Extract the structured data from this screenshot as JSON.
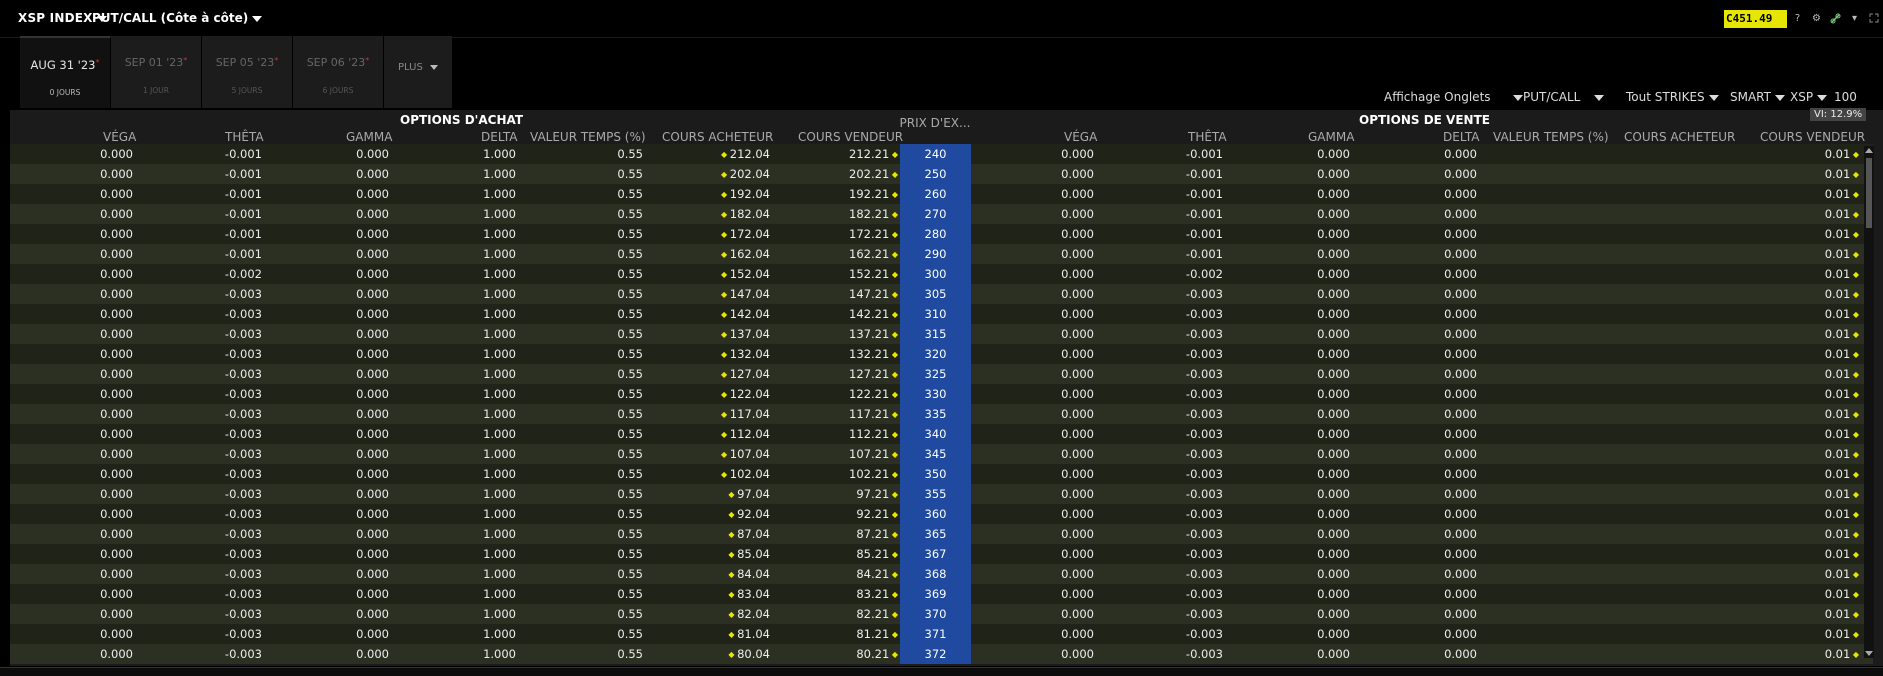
{
  "toolbar": {
    "symbol": "XSP INDEX",
    "view": "PUT/CALL (Côte à côte)",
    "price": "C451.49",
    "help": "?"
  },
  "tabs": [
    {
      "date": "AUG 31 '23",
      "days": "0 JOURS",
      "active": true
    },
    {
      "date": "SEP 01 '23",
      "days": "1 JOUR",
      "active": false
    },
    {
      "date": "SEP 05 '23",
      "days": "5 JOURS",
      "active": false
    },
    {
      "date": "SEP 06 '23",
      "days": "6 JOURS",
      "active": false
    }
  ],
  "more_tab": "PLUS",
  "controls": {
    "display": "Affichage Onglets",
    "putcall": "PUT/CALL",
    "strikes": "Tout STRIKES",
    "exchange": "SMART",
    "underlying": "XSP",
    "multiplier": "100"
  },
  "calls": {
    "title": "OPTIONS D'ACHAT",
    "columns": [
      "VÉGA",
      "THÊTA",
      "GAMMA",
      "DELTA",
      "VALEUR TEMPS (%)",
      "COURS ACHETEUR",
      "COURS VENDEUR"
    ]
  },
  "strike_header": "PRIX D'EX...",
  "puts": {
    "title": "OPTIONS DE VENTE",
    "columns": [
      "VÉGA",
      "THÊTA",
      "GAMMA",
      "DELTA",
      "VALEUR TEMPS (%)",
      "COURS ACHETEUR",
      "COURS VENDEUR"
    ]
  },
  "vi": "VI: 12.9%",
  "rows": [
    {
      "cv": "0.000",
      "ct": "-0.001",
      "cg": "0.000",
      "cd": "1.000",
      "ctv": "0.55",
      "cb": "212.04",
      "ca": "212.21",
      "strike": "240",
      "pv": "0.000",
      "pt": "-0.001",
      "pg": "0.000",
      "pd": "0.000",
      "pa": "0.01"
    },
    {
      "cv": "0.000",
      "ct": "-0.001",
      "cg": "0.000",
      "cd": "1.000",
      "ctv": "0.55",
      "cb": "202.04",
      "ca": "202.21",
      "strike": "250",
      "pv": "0.000",
      "pt": "-0.001",
      "pg": "0.000",
      "pd": "0.000",
      "pa": "0.01"
    },
    {
      "cv": "0.000",
      "ct": "-0.001",
      "cg": "0.000",
      "cd": "1.000",
      "ctv": "0.55",
      "cb": "192.04",
      "ca": "192.21",
      "strike": "260",
      "pv": "0.000",
      "pt": "-0.001",
      "pg": "0.000",
      "pd": "0.000",
      "pa": "0.01"
    },
    {
      "cv": "0.000",
      "ct": "-0.001",
      "cg": "0.000",
      "cd": "1.000",
      "ctv": "0.55",
      "cb": "182.04",
      "ca": "182.21",
      "strike": "270",
      "pv": "0.000",
      "pt": "-0.001",
      "pg": "0.000",
      "pd": "0.000",
      "pa": "0.01"
    },
    {
      "cv": "0.000",
      "ct": "-0.001",
      "cg": "0.000",
      "cd": "1.000",
      "ctv": "0.55",
      "cb": "172.04",
      "ca": "172.21",
      "strike": "280",
      "pv": "0.000",
      "pt": "-0.001",
      "pg": "0.000",
      "pd": "0.000",
      "pa": "0.01"
    },
    {
      "cv": "0.000",
      "ct": "-0.001",
      "cg": "0.000",
      "cd": "1.000",
      "ctv": "0.55",
      "cb": "162.04",
      "ca": "162.21",
      "strike": "290",
      "pv": "0.000",
      "pt": "-0.001",
      "pg": "0.000",
      "pd": "0.000",
      "pa": "0.01"
    },
    {
      "cv": "0.000",
      "ct": "-0.002",
      "cg": "0.000",
      "cd": "1.000",
      "ctv": "0.55",
      "cb": "152.04",
      "ca": "152.21",
      "strike": "300",
      "pv": "0.000",
      "pt": "-0.002",
      "pg": "0.000",
      "pd": "0.000",
      "pa": "0.01"
    },
    {
      "cv": "0.000",
      "ct": "-0.003",
      "cg": "0.000",
      "cd": "1.000",
      "ctv": "0.55",
      "cb": "147.04",
      "ca": "147.21",
      "strike": "305",
      "pv": "0.000",
      "pt": "-0.003",
      "pg": "0.000",
      "pd": "0.000",
      "pa": "0.01"
    },
    {
      "cv": "0.000",
      "ct": "-0.003",
      "cg": "0.000",
      "cd": "1.000",
      "ctv": "0.55",
      "cb": "142.04",
      "ca": "142.21",
      "strike": "310",
      "pv": "0.000",
      "pt": "-0.003",
      "pg": "0.000",
      "pd": "0.000",
      "pa": "0.01"
    },
    {
      "cv": "0.000",
      "ct": "-0.003",
      "cg": "0.000",
      "cd": "1.000",
      "ctv": "0.55",
      "cb": "137.04",
      "ca": "137.21",
      "strike": "315",
      "pv": "0.000",
      "pt": "-0.003",
      "pg": "0.000",
      "pd": "0.000",
      "pa": "0.01"
    },
    {
      "cv": "0.000",
      "ct": "-0.003",
      "cg": "0.000",
      "cd": "1.000",
      "ctv": "0.55",
      "cb": "132.04",
      "ca": "132.21",
      "strike": "320",
      "pv": "0.000",
      "pt": "-0.003",
      "pg": "0.000",
      "pd": "0.000",
      "pa": "0.01"
    },
    {
      "cv": "0.000",
      "ct": "-0.003",
      "cg": "0.000",
      "cd": "1.000",
      "ctv": "0.55",
      "cb": "127.04",
      "ca": "127.21",
      "strike": "325",
      "pv": "0.000",
      "pt": "-0.003",
      "pg": "0.000",
      "pd": "0.000",
      "pa": "0.01"
    },
    {
      "cv": "0.000",
      "ct": "-0.003",
      "cg": "0.000",
      "cd": "1.000",
      "ctv": "0.55",
      "cb": "122.04",
      "ca": "122.21",
      "strike": "330",
      "pv": "0.000",
      "pt": "-0.003",
      "pg": "0.000",
      "pd": "0.000",
      "pa": "0.01"
    },
    {
      "cv": "0.000",
      "ct": "-0.003",
      "cg": "0.000",
      "cd": "1.000",
      "ctv": "0.55",
      "cb": "117.04",
      "ca": "117.21",
      "strike": "335",
      "pv": "0.000",
      "pt": "-0.003",
      "pg": "0.000",
      "pd": "0.000",
      "pa": "0.01"
    },
    {
      "cv": "0.000",
      "ct": "-0.003",
      "cg": "0.000",
      "cd": "1.000",
      "ctv": "0.55",
      "cb": "112.04",
      "ca": "112.21",
      "strike": "340",
      "pv": "0.000",
      "pt": "-0.003",
      "pg": "0.000",
      "pd": "0.000",
      "pa": "0.01"
    },
    {
      "cv": "0.000",
      "ct": "-0.003",
      "cg": "0.000",
      "cd": "1.000",
      "ctv": "0.55",
      "cb": "107.04",
      "ca": "107.21",
      "strike": "345",
      "pv": "0.000",
      "pt": "-0.003",
      "pg": "0.000",
      "pd": "0.000",
      "pa": "0.01"
    },
    {
      "cv": "0.000",
      "ct": "-0.003",
      "cg": "0.000",
      "cd": "1.000",
      "ctv": "0.55",
      "cb": "102.04",
      "ca": "102.21",
      "strike": "350",
      "pv": "0.000",
      "pt": "-0.003",
      "pg": "0.000",
      "pd": "0.000",
      "pa": "0.01"
    },
    {
      "cv": "0.000",
      "ct": "-0.003",
      "cg": "0.000",
      "cd": "1.000",
      "ctv": "0.55",
      "cb": "97.04",
      "ca": "97.21",
      "strike": "355",
      "pv": "0.000",
      "pt": "-0.003",
      "pg": "0.000",
      "pd": "0.000",
      "pa": "0.01"
    },
    {
      "cv": "0.000",
      "ct": "-0.003",
      "cg": "0.000",
      "cd": "1.000",
      "ctv": "0.55",
      "cb": "92.04",
      "ca": "92.21",
      "strike": "360",
      "pv": "0.000",
      "pt": "-0.003",
      "pg": "0.000",
      "pd": "0.000",
      "pa": "0.01"
    },
    {
      "cv": "0.000",
      "ct": "-0.003",
      "cg": "0.000",
      "cd": "1.000",
      "ctv": "0.55",
      "cb": "87.04",
      "ca": "87.21",
      "strike": "365",
      "pv": "0.000",
      "pt": "-0.003",
      "pg": "0.000",
      "pd": "0.000",
      "pa": "0.01"
    },
    {
      "cv": "0.000",
      "ct": "-0.003",
      "cg": "0.000",
      "cd": "1.000",
      "ctv": "0.55",
      "cb": "85.04",
      "ca": "85.21",
      "strike": "367",
      "pv": "0.000",
      "pt": "-0.003",
      "pg": "0.000",
      "pd": "0.000",
      "pa": "0.01"
    },
    {
      "cv": "0.000",
      "ct": "-0.003",
      "cg": "0.000",
      "cd": "1.000",
      "ctv": "0.55",
      "cb": "84.04",
      "ca": "84.21",
      "strike": "368",
      "pv": "0.000",
      "pt": "-0.003",
      "pg": "0.000",
      "pd": "0.000",
      "pa": "0.01"
    },
    {
      "cv": "0.000",
      "ct": "-0.003",
      "cg": "0.000",
      "cd": "1.000",
      "ctv": "0.55",
      "cb": "83.04",
      "ca": "83.21",
      "strike": "369",
      "pv": "0.000",
      "pt": "-0.003",
      "pg": "0.000",
      "pd": "0.000",
      "pa": "0.01"
    },
    {
      "cv": "0.000",
      "ct": "-0.003",
      "cg": "0.000",
      "cd": "1.000",
      "ctv": "0.55",
      "cb": "82.04",
      "ca": "82.21",
      "strike": "370",
      "pv": "0.000",
      "pt": "-0.003",
      "pg": "0.000",
      "pd": "0.000",
      "pa": "0.01"
    },
    {
      "cv": "0.000",
      "ct": "-0.003",
      "cg": "0.000",
      "cd": "1.000",
      "ctv": "0.55",
      "cb": "81.04",
      "ca": "81.21",
      "strike": "371",
      "pv": "0.000",
      "pt": "-0.003",
      "pg": "0.000",
      "pd": "0.000",
      "pa": "0.01"
    },
    {
      "cv": "0.000",
      "ct": "-0.003",
      "cg": "0.000",
      "cd": "1.000",
      "ctv": "0.55",
      "cb": "80.04",
      "ca": "80.21",
      "strike": "372",
      "pv": "0.000",
      "pt": "-0.003",
      "pg": "0.000",
      "pd": "0.000",
      "pa": "0.01"
    }
  ],
  "colors": {
    "strike_bg": "#1f4aa0",
    "price_badge": "#e6e600",
    "row_dark": "#1f2318",
    "row_light": "#2b3023",
    "marker": "#e6e600"
  }
}
